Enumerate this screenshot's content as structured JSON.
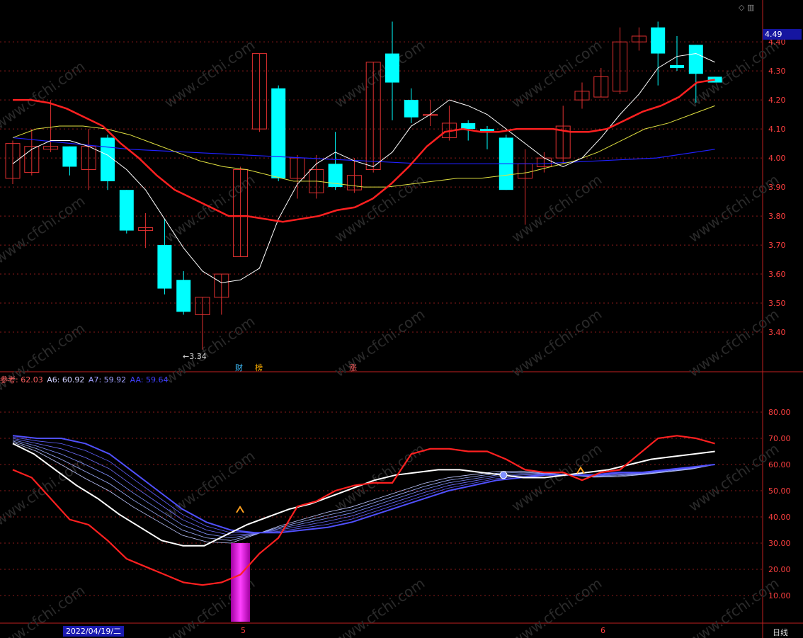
{
  "price_badge": "4.49",
  "min_label": "←3.34",
  "markers": {
    "cai": "财",
    "bang": "榜",
    "zhang": "涨"
  },
  "top_icons": "◇ ▥",
  "indicator_legend": {
    "ref": "参考: 62.03",
    "a6": "A6: 60.92",
    "a7": "A7: 59.92",
    "aa": "AA: 59.64"
  },
  "bottom_axis": {
    "date": "2022/04/19/二",
    "m5": "5",
    "m6": "6",
    "period": "日线"
  },
  "watermark": "www.cfchi.com",
  "colors": {
    "bg": "#000000",
    "up": "#e03030",
    "down": "#00ffff",
    "ma_red": "#ff2020",
    "ma_white": "#ffffff",
    "ma_yellow": "#e0e040",
    "ma_blue": "#2020ff",
    "grid": "#8a1a1a",
    "axis": "#c02020"
  },
  "chart_data": [
    {
      "type": "candlestick",
      "ylim": [
        3.3,
        4.52
      ],
      "yticks": [
        "4.40",
        "4.30",
        "4.20",
        "4.10",
        "4.00",
        "3.90",
        "3.80",
        "3.70",
        "3.60",
        "3.50",
        "3.40"
      ],
      "candles": [
        {
          "o": 3.93,
          "c": 4.05,
          "h": 4.06,
          "l": 3.91
        },
        {
          "o": 3.95,
          "c": 4.04,
          "h": 4.1,
          "l": 3.94
        },
        {
          "o": 4.03,
          "c": 4.04,
          "h": 4.2,
          "l": 4.02
        },
        {
          "o": 4.04,
          "c": 3.97,
          "h": 4.04,
          "l": 3.94
        },
        {
          "o": 3.96,
          "c": 4.04,
          "h": 4.1,
          "l": 3.89
        },
        {
          "o": 4.07,
          "c": 3.92,
          "h": 4.08,
          "l": 3.89
        },
        {
          "o": 3.89,
          "c": 3.75,
          "h": 3.89,
          "l": 3.74
        },
        {
          "o": 3.75,
          "c": 3.76,
          "h": 3.81,
          "l": 3.69
        },
        {
          "o": 3.7,
          "c": 3.55,
          "h": 3.79,
          "l": 3.53
        },
        {
          "o": 3.58,
          "c": 3.47,
          "h": 3.61,
          "l": 3.46
        },
        {
          "o": 3.46,
          "c": 3.52,
          "h": 3.52,
          "l": 3.34
        },
        {
          "o": 3.52,
          "c": 3.6,
          "h": 3.6,
          "l": 3.46
        },
        {
          "o": 3.66,
          "c": 3.96,
          "h": 3.97,
          "l": 3.66
        },
        {
          "o": 4.1,
          "c": 4.36,
          "h": 4.36,
          "l": 4.09
        },
        {
          "o": 4.24,
          "c": 3.93,
          "h": 4.25,
          "l": 3.92
        },
        {
          "o": 3.93,
          "c": 4.0,
          "h": 4.01,
          "l": 3.86
        },
        {
          "o": 3.88,
          "c": 3.96,
          "h": 4.01,
          "l": 3.86
        },
        {
          "o": 3.98,
          "c": 3.9,
          "h": 4.09,
          "l": 3.89
        },
        {
          "o": 3.89,
          "c": 3.94,
          "h": 4.0,
          "l": 3.88
        },
        {
          "o": 3.96,
          "c": 4.33,
          "h": 4.33,
          "l": 3.95
        },
        {
          "o": 4.36,
          "c": 4.26,
          "h": 4.47,
          "l": 4.13
        },
        {
          "o": 4.2,
          "c": 4.14,
          "h": 4.24,
          "l": 4.12
        },
        {
          "o": 4.15,
          "c": 4.15,
          "h": 4.2,
          "l": 4.11
        },
        {
          "o": 4.07,
          "c": 4.12,
          "h": 4.18,
          "l": 4.06
        },
        {
          "o": 4.12,
          "c": 4.1,
          "h": 4.13,
          "l": 4.06
        },
        {
          "o": 4.1,
          "c": 4.09,
          "h": 4.11,
          "l": 4.03
        },
        {
          "o": 4.07,
          "c": 3.89,
          "h": 4.08,
          "l": 3.89
        },
        {
          "o": 3.93,
          "c": 3.98,
          "h": 4.03,
          "l": 3.77
        },
        {
          "o": 3.97,
          "c": 4.0,
          "h": 4.02,
          "l": 3.95
        },
        {
          "o": 4.0,
          "c": 4.11,
          "h": 4.18,
          "l": 3.98
        },
        {
          "o": 4.2,
          "c": 4.23,
          "h": 4.26,
          "l": 4.17
        },
        {
          "o": 4.21,
          "c": 4.28,
          "h": 4.31,
          "l": 4.21
        },
        {
          "o": 4.23,
          "c": 4.4,
          "h": 4.45,
          "l": 4.22
        },
        {
          "o": 4.4,
          "c": 4.42,
          "h": 4.45,
          "l": 4.37
        },
        {
          "o": 4.45,
          "c": 4.36,
          "h": 4.47,
          "l": 4.25
        },
        {
          "o": 4.32,
          "c": 4.31,
          "h": 4.42,
          "l": 4.3
        },
        {
          "o": 4.39,
          "c": 4.29,
          "h": 4.39,
          "l": 4.19
        },
        {
          "o": 4.28,
          "c": 4.26,
          "h": 4.28,
          "l": 4.26
        }
      ],
      "ma_red": [
        4.2,
        4.2,
        4.19,
        4.17,
        4.14,
        4.11,
        4.05,
        4.0,
        3.94,
        3.89,
        3.86,
        3.83,
        3.8,
        3.8,
        3.79,
        3.78,
        3.79,
        3.8,
        3.82,
        3.83,
        3.86,
        3.91,
        3.97,
        4.04,
        4.09,
        4.1,
        4.09,
        4.09,
        4.1,
        4.1,
        4.1,
        4.09,
        4.09,
        4.1,
        4.13,
        4.16,
        4.18,
        4.21,
        4.26,
        4.27
      ],
      "ma_white": [
        3.98,
        4.03,
        4.06,
        4.06,
        4.04,
        4.01,
        3.96,
        3.89,
        3.79,
        3.69,
        3.61,
        3.57,
        3.58,
        3.62,
        3.79,
        3.91,
        3.98,
        4.02,
        3.99,
        3.97,
        4.02,
        4.11,
        4.15,
        4.2,
        4.18,
        4.15,
        4.1,
        4.05,
        4.0,
        3.97,
        4.0,
        4.07,
        4.15,
        4.22,
        4.31,
        4.35,
        4.36,
        4.33
      ],
      "ma_yellow": [
        4.07,
        4.1,
        4.11,
        4.11,
        4.1,
        4.08,
        4.05,
        4.02,
        3.99,
        3.97,
        3.96,
        3.94,
        3.92,
        3.92,
        3.91,
        3.9,
        3.9,
        3.91,
        3.92,
        3.93,
        3.93,
        3.94,
        3.95,
        3.97,
        3.99,
        4.02,
        4.06,
        4.1,
        4.12,
        4.15,
        4.18
      ],
      "ma_blue": [
        4.07,
        4.05,
        4.03,
        4.02,
        4.01,
        4.0,
        3.99,
        3.98,
        3.98,
        3.98,
        3.99,
        4.0,
        4.03
      ]
    },
    {
      "type": "line",
      "ylim": [
        0,
        90
      ],
      "yticks": [
        "80.00",
        "70.00",
        "60.00",
        "50.00",
        "40.00",
        "30.00",
        "20.00",
        "10.00"
      ],
      "series": [
        {
          "name": "参考",
          "color": "#ff2020",
          "values": [
            58,
            55,
            47,
            39,
            37,
            31,
            24,
            21,
            18,
            15,
            14,
            15,
            18,
            26,
            32,
            44,
            46,
            50,
            52,
            53,
            53,
            64,
            66,
            66,
            65,
            65,
            62,
            58,
            57,
            57,
            54,
            57,
            58,
            64,
            70,
            71,
            70,
            68
          ]
        },
        {
          "name": "A6",
          "color": "#ffffff",
          "values": [
            68,
            64,
            58,
            52,
            47,
            41,
            36,
            31,
            29,
            29,
            33,
            37,
            40,
            43,
            45,
            48,
            51,
            54,
            56,
            57,
            58,
            58,
            57,
            56,
            55,
            55,
            56,
            57,
            58,
            60,
            62,
            63,
            64,
            65
          ]
        },
        {
          "name": "AA",
          "color": "#5050ff",
          "values": [
            71,
            70,
            70,
            68,
            64,
            57,
            50,
            43,
            38,
            35,
            34,
            34,
            35,
            36,
            38,
            41,
            44,
            47,
            50,
            52,
            54,
            55,
            56,
            56,
            56,
            57,
            57,
            58,
            59,
            60
          ]
        }
      ],
      "bar": {
        "value_from": 0,
        "value_to": 30,
        "color": "#e020e0"
      }
    }
  ]
}
